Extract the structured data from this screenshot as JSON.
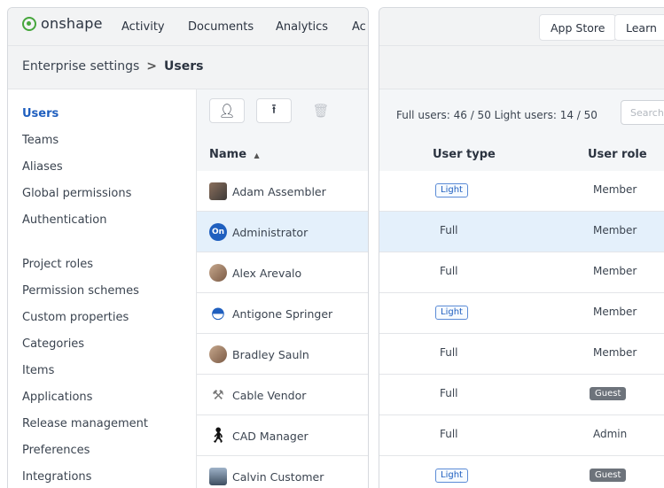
{
  "app": {
    "logo_text": "onshape",
    "nav": [
      "Activity",
      "Documents",
      "Analytics",
      "Ac"
    ]
  },
  "breadcrumb": {
    "parent": "Enterprise settings",
    "separator": ">",
    "current": "Users"
  },
  "sidebar": {
    "items": [
      {
        "label": "Users",
        "active": true
      },
      {
        "label": "Teams"
      },
      {
        "label": "Aliases"
      },
      {
        "label": "Global permissions"
      },
      {
        "label": "Authentication"
      },
      {
        "label": "Project roles"
      },
      {
        "label": "Permission schemes"
      },
      {
        "label": "Custom properties"
      },
      {
        "label": "Categories"
      },
      {
        "label": "Items"
      },
      {
        "label": "Applications"
      },
      {
        "label": "Release management"
      },
      {
        "label": "Preferences"
      },
      {
        "label": "Integrations"
      }
    ]
  },
  "toolbar": {
    "add_user_icon": "add-user-icon",
    "upload_icon": "upload-icon",
    "delete_icon": "trash-icon"
  },
  "table": {
    "headers": {
      "name": "Name",
      "sort_indicator": "▲",
      "user_type": "User type",
      "user_role": "User role"
    },
    "rows": [
      {
        "name": "Adam Assembler",
        "type": "Light",
        "role": "Member",
        "avatar": "photo"
      },
      {
        "name": "Administrator",
        "type": "Full",
        "role": "Member",
        "avatar": "On",
        "selected": true
      },
      {
        "name": "Alex Arevalo",
        "type": "Full",
        "role": "Member",
        "avatar": "photo"
      },
      {
        "name": "Antigone Springer",
        "type": "Light",
        "role": "Member",
        "avatar": "user"
      },
      {
        "name": "Bradley Sauln",
        "type": "Full",
        "role": "Member",
        "avatar": "photo"
      },
      {
        "name": "Cable Vendor",
        "type": "Full",
        "role": "Guest",
        "avatar": "tool"
      },
      {
        "name": "CAD Manager",
        "type": "Full",
        "role": "Admin",
        "avatar": "cad"
      },
      {
        "name": "Calvin Customer",
        "type": "Light",
        "role": "Guest",
        "avatar": "photo"
      }
    ]
  },
  "right_header": {
    "tabs": [
      "App Store",
      "Learn"
    ]
  },
  "counts": "Full users: 46 / 50   Light users: 14 / 50",
  "search": {
    "placeholder": "Search"
  },
  "colors": {
    "accent": "#1f5fbf",
    "brand": "#46a63c",
    "selected_row": "#e4f0fb"
  }
}
